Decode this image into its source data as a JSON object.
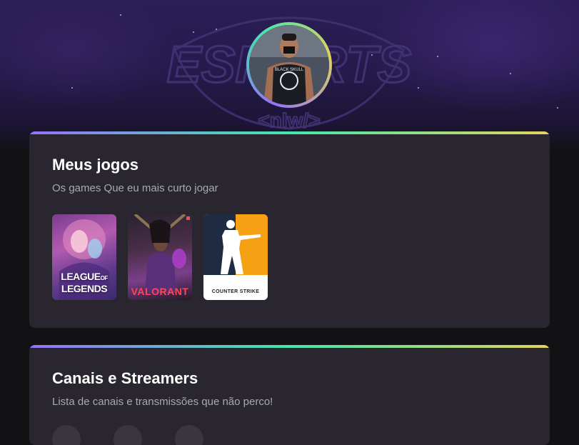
{
  "header": {
    "banner_text": "ESPORTS",
    "banner_sub": "<nlw/>"
  },
  "profile": {
    "avatar_shirt_text": "BLACK SKULL"
  },
  "games_section": {
    "title": "Meus jogos",
    "subtitle": "Os games Que eu mais curto jogar",
    "games": [
      {
        "name": "LEAGUE OF LEGENDS",
        "line1": "LEAGUE",
        "line2": "LEGENDS",
        "of": "OF"
      },
      {
        "name": "VALORANT"
      },
      {
        "name": "COUNTER STRIKE"
      }
    ]
  },
  "channels_section": {
    "title": "Canais e Streamers",
    "subtitle": "Lista de canais e transmissões que não perco!"
  },
  "colors": {
    "background": "#121214",
    "card": "#29262f",
    "gradient": [
      "#9572fc",
      "#43e7ad",
      "#e2d45c"
    ],
    "text_primary": "#ffffff",
    "text_secondary": "#a8a8b3"
  }
}
